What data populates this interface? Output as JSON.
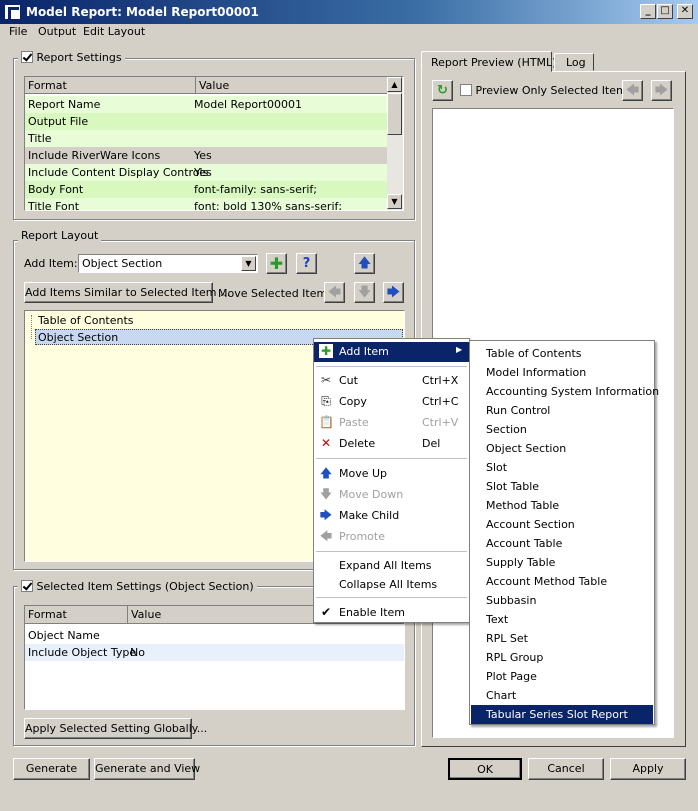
{
  "window": {
    "title": "Model Report: Model Report00001",
    "min": "_",
    "max": "□",
    "close": "✕"
  },
  "menubar": [
    "File",
    "Output",
    "Edit Layout"
  ],
  "report_settings": {
    "label": "Report Settings",
    "headers": [
      "Format",
      "Value"
    ],
    "rows": [
      [
        "Report Name",
        "Model Report00001"
      ],
      [
        "Output File",
        ""
      ],
      [
        "Title",
        ""
      ],
      [
        "Include RiverWare Icons",
        "Yes"
      ],
      [
        "Include Content Display Controls",
        "Yes"
      ],
      [
        "Body Font",
        "font-family: sans-serif;"
      ],
      [
        "Title Font",
        "font: bold 130% sans-serif;"
      ]
    ]
  },
  "report_layout": {
    "label": "Report Layout",
    "add_item_label": "Add Item:",
    "add_item_value": "Object Section",
    "add_similar": "Add Items Similar to Selected Item ...",
    "move_label": "Move Selected Item:",
    "tree": [
      "Table of Contents",
      "Object Section"
    ]
  },
  "selected_settings": {
    "label": "Selected Item Settings (Object Section)",
    "headers": [
      "Format",
      "Value"
    ],
    "rows": [
      [
        "Object Name",
        ""
      ],
      [
        "Include Object Type",
        "No"
      ]
    ],
    "apply_global": "Apply Selected Setting Globally..."
  },
  "preview": {
    "tabs": [
      "Report Preview (HTML)",
      "Log"
    ],
    "only_selected": "Preview Only Selected Item"
  },
  "buttons": {
    "generate": "Generate",
    "generate_view": "Generate and View",
    "ok": "OK",
    "cancel": "Cancel",
    "apply": "Apply"
  },
  "context_menu": {
    "add_item": "Add Item",
    "cut": "Cut",
    "cut_sc": "Ctrl+X",
    "copy": "Copy",
    "copy_sc": "Ctrl+C",
    "paste": "Paste",
    "paste_sc": "Ctrl+V",
    "delete": "Delete",
    "delete_sc": "Del",
    "move_up": "Move Up",
    "move_down": "Move Down",
    "make_child": "Make Child",
    "promote": "Promote",
    "expand_all": "Expand All Items",
    "collapse_all": "Collapse All Items",
    "enable_item": "Enable Item"
  },
  "submenu": [
    "Table of Contents",
    "Model Information",
    "Accounting System Information",
    "Run Control",
    "Section",
    "Object Section",
    "Slot",
    "Slot Table",
    "Method Table",
    "Account Section",
    "Account Table",
    "Supply Table",
    "Account Method Table",
    "Subbasin",
    "Text",
    "RPL Set",
    "RPL Group",
    "Plot Page",
    "Chart",
    "Tabular Series Slot Report"
  ],
  "colors": {
    "title_blue": "#0a246a",
    "row_green": "#e8fcd8",
    "tree_yellow": "#ffffe0",
    "selection": "#0a246a"
  }
}
